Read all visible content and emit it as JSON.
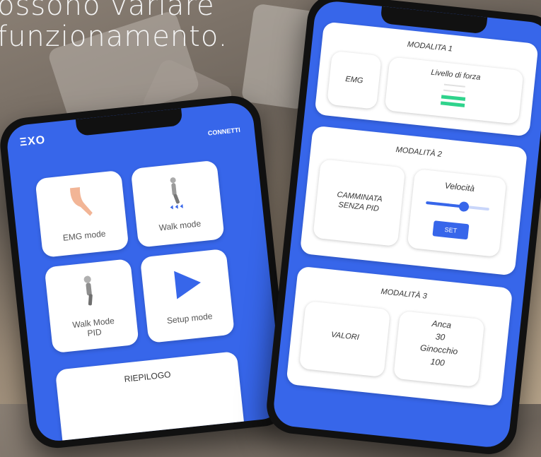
{
  "background": {
    "headline_line1": "ossono variare",
    "headline_line2": "funzionamento."
  },
  "left_phone": {
    "logo": "ΞXO",
    "connect_label": "CONNETTI",
    "tiles": [
      {
        "label": "EMG mode",
        "icon": "leg-icon"
      },
      {
        "label": "Walk mode",
        "icon": "walking-robot-icon"
      },
      {
        "label": "Walk Mode PID",
        "icon": "robot-leg-icon"
      },
      {
        "label": "Setup mode",
        "icon": "play-icon"
      }
    ],
    "summary_title": "RIEPILOGO"
  },
  "right_phone": {
    "mode1": {
      "title": "MODALITA 1",
      "emg_label": "EMG",
      "force_label": "Livello di forza",
      "force_level": 0.4
    },
    "mode2": {
      "title": "MODALITÀ 2",
      "walk_label_line1": "CAMMINATA",
      "walk_label_line2": "SENZA PID",
      "speed_label": "Velocità",
      "speed_value": 0.6,
      "set_label": "SET"
    },
    "mode3": {
      "title": "MODALITÀ 3",
      "values_label": "VALORI",
      "hip_label": "Anca",
      "hip_value": "30",
      "knee_label": "Ginocchio",
      "knee_value": "100"
    }
  },
  "colors": {
    "accent": "#3766ea",
    "green": "#2fd38c"
  }
}
